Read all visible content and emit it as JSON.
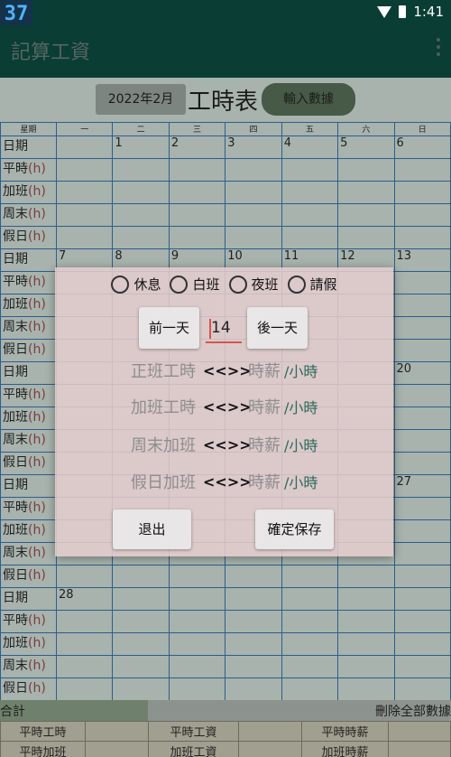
{
  "status": {
    "badge": "37",
    "time": "1:41"
  },
  "app": {
    "title": "記算工資"
  },
  "header": {
    "month": "2022年2月",
    "title": "工時表",
    "input_button": "輸入數據"
  },
  "grid": {
    "columns": [
      "星期",
      "一",
      "二",
      "三",
      "四",
      "五",
      "六",
      "日"
    ],
    "row_labels": [
      {
        "text": "日期",
        "unit": ""
      },
      {
        "text": "平時",
        "unit": "(h)"
      },
      {
        "text": "加班",
        "unit": "(h)"
      },
      {
        "text": "周末",
        "unit": "(h)"
      },
      {
        "text": "假日",
        "unit": "(h)"
      }
    ],
    "weeks": [
      [
        "",
        "1",
        "2",
        "3",
        "4",
        "5",
        "6"
      ],
      [
        "7",
        "8",
        "9",
        "10",
        "11",
        "12",
        "13"
      ],
      [
        "",
        "",
        "",
        "",
        "",
        "",
        "20"
      ],
      [
        "",
        "",
        "",
        "",
        "",
        "",
        "27"
      ],
      [
        "28",
        "",
        "",
        "",
        "",
        "",
        ""
      ]
    ]
  },
  "summary": {
    "total_label": "合計",
    "clear_label": "刪除全部數據",
    "rows": [
      [
        "平時工時",
        "",
        "平時工資",
        "",
        "平時時薪",
        ""
      ],
      [
        "平時加班",
        "",
        "加班工資",
        "",
        "加班時薪",
        ""
      ]
    ]
  },
  "dialog": {
    "options": [
      "休息",
      "白班",
      "夜班",
      "請假"
    ],
    "prev_label": "前一天",
    "next_label": "後一天",
    "day_value": "14",
    "rates": [
      {
        "name": "正班工時",
        "arrows": "<<>>",
        "value": "時薪",
        "unit": "/小時"
      },
      {
        "name": "加班工時",
        "arrows": "<<>>",
        "value": "時薪",
        "unit": "/小時"
      },
      {
        "name": "周末加班",
        "arrows": "<<>>",
        "value": "時薪",
        "unit": "/小時"
      },
      {
        "name": "假日加班",
        "arrows": "<<>>",
        "value": "時薪",
        "unit": "/小時"
      }
    ],
    "exit_label": "退出",
    "save_label": "確定保存"
  }
}
